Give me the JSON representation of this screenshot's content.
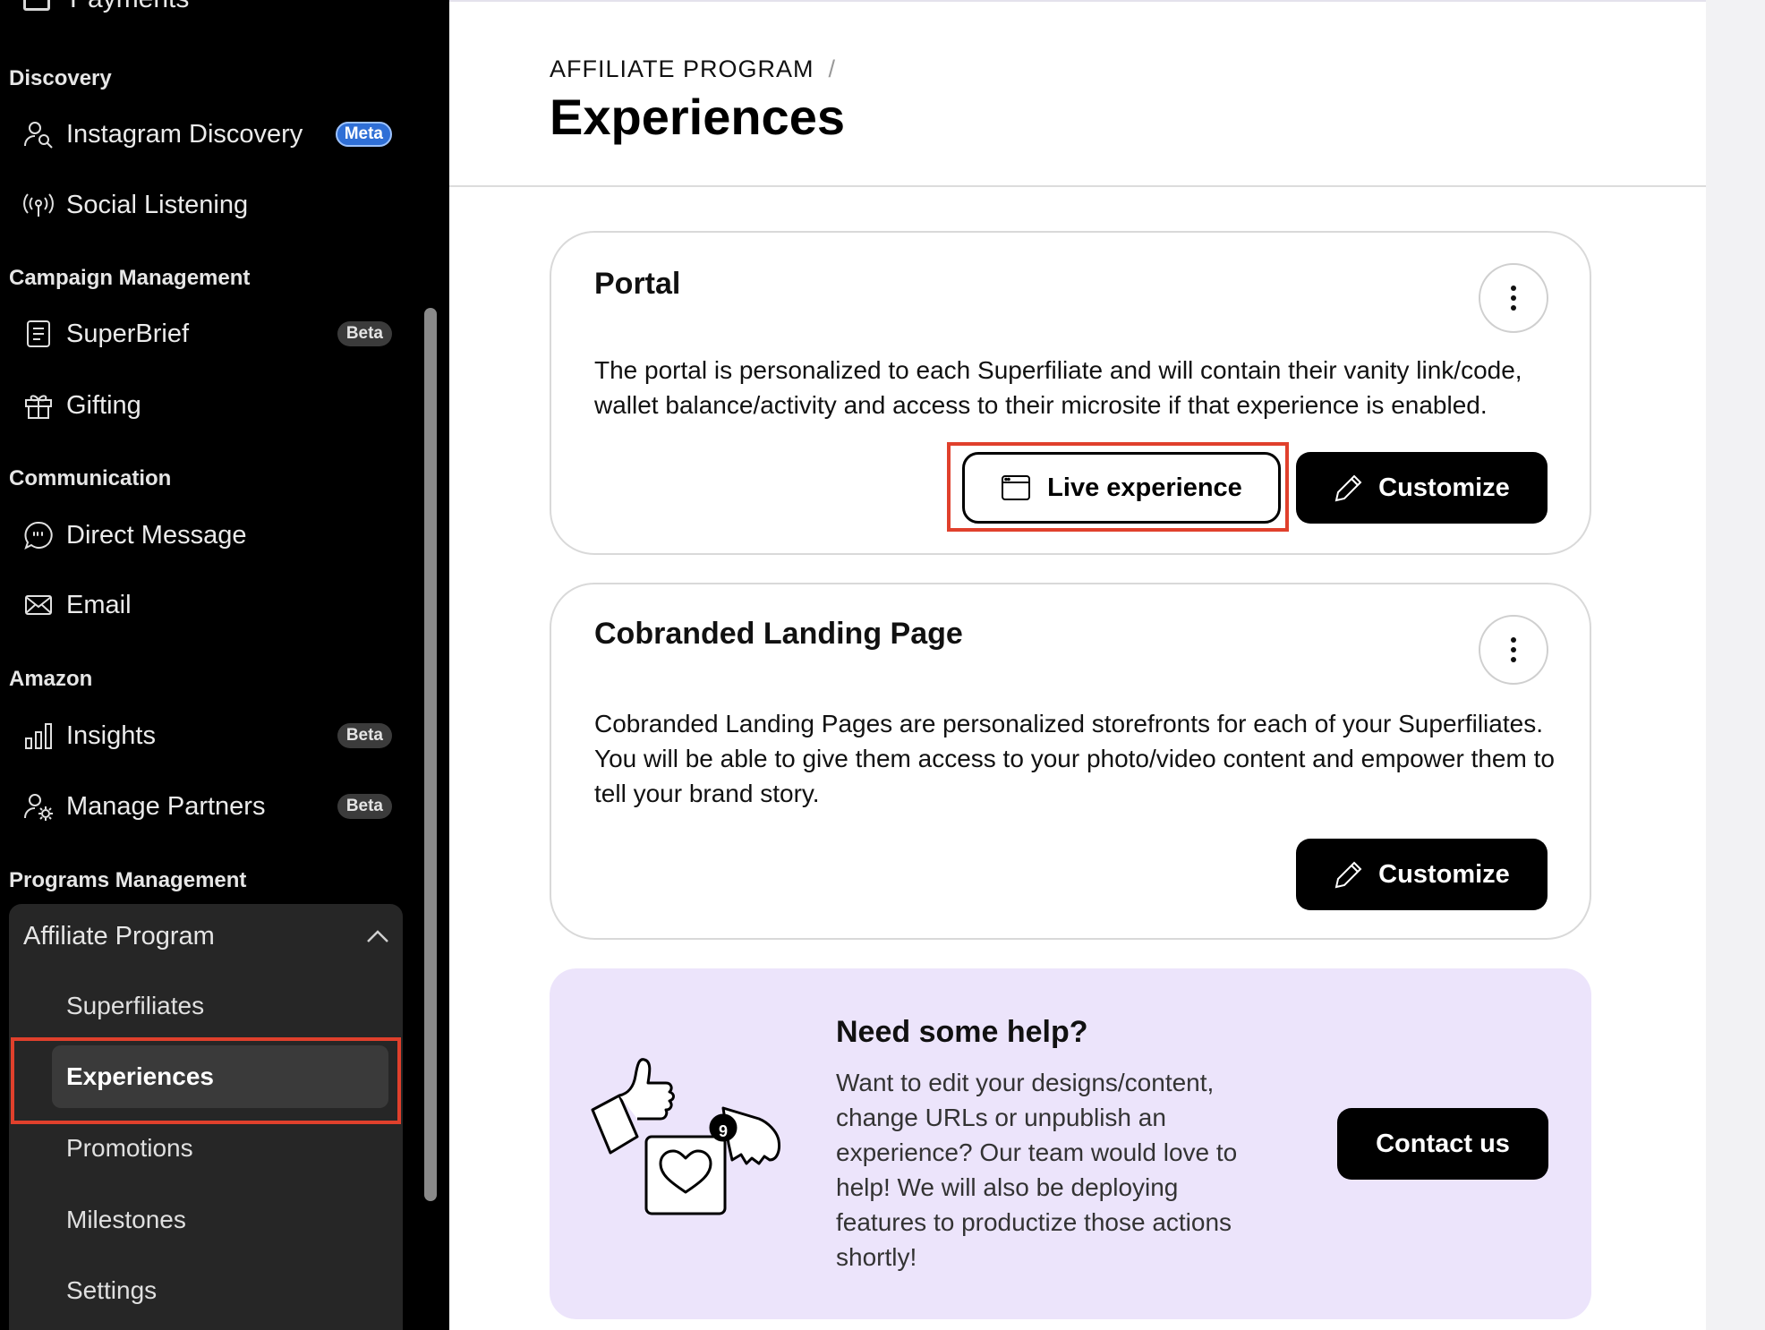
{
  "sidebar": {
    "cut_item_label": "Payments",
    "sections": {
      "discovery": "Discovery",
      "campaign": "Campaign Management",
      "communication": "Communication",
      "amazon": "Amazon",
      "programs": "Programs Management"
    },
    "items": {
      "instagram_discovery": {
        "label": "Instagram Discovery",
        "badge": "Meta",
        "icon": "user-search-icon"
      },
      "social_listening": {
        "label": "Social Listening",
        "icon": "broadcast-icon"
      },
      "superbrief": {
        "label": "SuperBrief",
        "badge": "Beta",
        "icon": "document-icon"
      },
      "gifting": {
        "label": "Gifting",
        "icon": "gift-icon"
      },
      "direct_message": {
        "label": "Direct Message",
        "icon": "chat-icon"
      },
      "email": {
        "label": "Email",
        "icon": "mail-icon"
      },
      "insights": {
        "label": "Insights",
        "badge": "Beta",
        "icon": "bar-chart-icon"
      },
      "manage_partners": {
        "label": "Manage Partners",
        "badge": "Beta",
        "icon": "user-gear-icon"
      }
    },
    "group": {
      "label": "Affiliate Program",
      "expanded": true,
      "subitems": [
        "Superfiliates",
        "Experiences",
        "Promotions",
        "Milestones",
        "Settings"
      ],
      "active": "Experiences"
    }
  },
  "header": {
    "breadcrumb": "AFFILIATE PROGRAM",
    "breadcrumb_sep": "/",
    "title": "Experiences"
  },
  "cards": {
    "portal": {
      "title": "Portal",
      "description": "The portal is personalized to each Superfiliate and will contain their vanity link/code, wallet balance/activity and access to their microsite if that experience is enabled.",
      "live_label": "Live experience",
      "customize_label": "Customize"
    },
    "landing": {
      "title": "Cobranded Landing Page",
      "description": "Cobranded Landing Pages are personalized storefronts for each of your Superfiliates. You will be able to give them access to your photo/video content and empower them to tell your brand story.",
      "customize_label": "Customize"
    }
  },
  "help": {
    "title": "Need some help?",
    "text": "Want to edit your designs/content, change URLs or unpublish an experience? Our team would love to help! We will also be deploying features to productize those actions shortly!",
    "button": "Contact us",
    "notification_count": "9"
  },
  "colors": {
    "sidebar_bg": "#000000",
    "group_bg": "#262626",
    "highlight": "#e0402c",
    "help_bg": "#ece4fb",
    "meta_badge": "#2f6fd6"
  }
}
